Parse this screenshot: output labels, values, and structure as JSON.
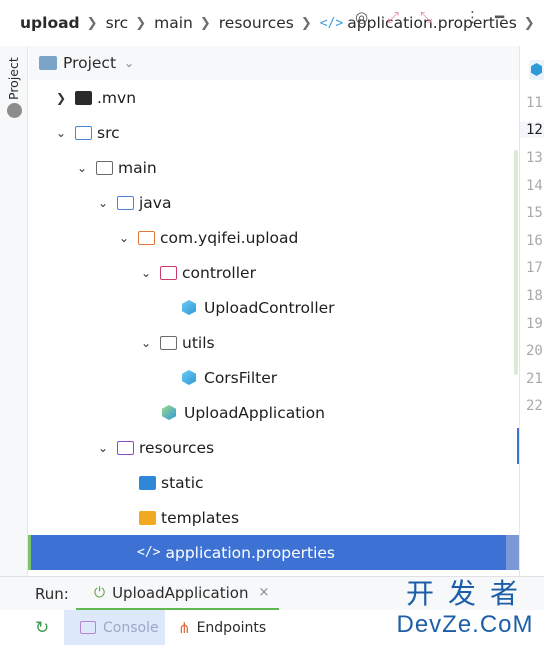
{
  "breadcrumb": {
    "items": [
      "upload",
      "src",
      "main",
      "resources",
      "application.properties"
    ]
  },
  "left_strip": {
    "label": "Project"
  },
  "project_panel": {
    "title": "Project",
    "icons": [
      "target-icon",
      "expand-icon",
      "collapse-icon",
      "more-icon",
      "minimize-icon"
    ]
  },
  "tree": [
    {
      "label": ".mvn",
      "depth": 1,
      "arrow": "›",
      "icon": "folder-icon"
    },
    {
      "label": "src",
      "depth": 1,
      "arrow": "⌄",
      "icon": "source-folder-icon"
    },
    {
      "label": "main",
      "depth": 2,
      "arrow": "⌄",
      "icon": "folder-icon"
    },
    {
      "label": "java",
      "depth": 3,
      "arrow": "⌄",
      "icon": "java-folder-icon"
    },
    {
      "label": "com.yqifei.upload",
      "depth": 4,
      "arrow": "⌄",
      "icon": "package-icon"
    },
    {
      "label": "controller",
      "depth": 5,
      "arrow": "⌄",
      "icon": "controller-package-icon"
    },
    {
      "label": "UploadController",
      "depth": 6,
      "arrow": "",
      "icon": "class-icon"
    },
    {
      "label": "utils",
      "depth": 5,
      "arrow": "⌄",
      "icon": "folder-icon"
    },
    {
      "label": "CorsFilter",
      "depth": 6,
      "arrow": "",
      "icon": "class-icon"
    },
    {
      "label": "UploadApplication",
      "depth": 5,
      "arrow": "",
      "icon": "spring-class-icon"
    },
    {
      "label": "resources",
      "depth": 3,
      "arrow": "⌄",
      "icon": "resources-folder-icon"
    },
    {
      "label": "static",
      "depth": 4,
      "arrow": "",
      "icon": "web-folder-icon"
    },
    {
      "label": "templates",
      "depth": 4,
      "arrow": "",
      "icon": "templates-folder-icon"
    },
    {
      "label": "application.properties",
      "depth": 4,
      "arrow": "",
      "icon": "properties-file-icon",
      "selected": true
    }
  ],
  "gutter": {
    "line_numbers": [
      "11",
      "12",
      "13",
      "14",
      "15",
      "16",
      "17",
      "18",
      "19",
      "20",
      "21",
      "22"
    ],
    "current_line": "12"
  },
  "run": {
    "label": "Run:",
    "tab": "UploadApplication",
    "close": "×"
  },
  "bottom": {
    "console": "Console",
    "endpoints": "Endpoints"
  },
  "watermark": {
    "cn": "开发者",
    "en": "DevZe.CoM"
  },
  "colors": {
    "selection": "#3d72d4",
    "run_tab_underline": "#5fb94f",
    "watermark": "#1c5fa8"
  }
}
